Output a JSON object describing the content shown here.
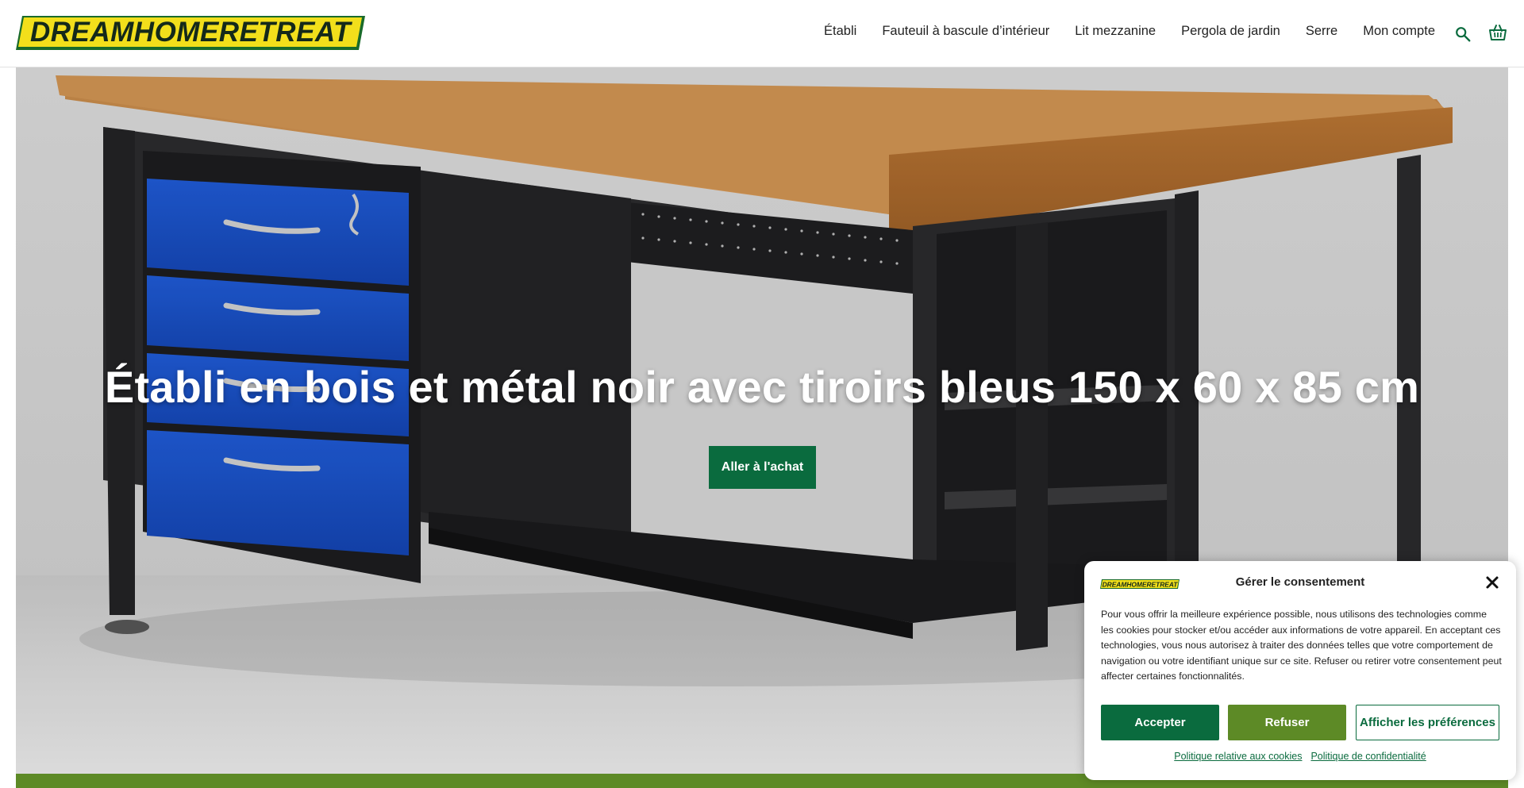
{
  "header": {
    "logo_text": "DREAMHOMERETREAT",
    "nav": [
      {
        "label": "Établi"
      },
      {
        "label": "Fauteuil à bascule d’intérieur"
      },
      {
        "label": "Lit mezzanine"
      },
      {
        "label": "Pergola de jardin"
      },
      {
        "label": "Serre"
      },
      {
        "label": "Mon compte"
      }
    ],
    "search_icon": "search-icon",
    "cart_icon": "shopping-basket-icon"
  },
  "hero": {
    "title": "Établi en bois et métal noir avec tiroirs bleus 150 x 60 x 85 cm",
    "cta_label": "Aller à l'achat"
  },
  "cookie": {
    "title": "Gérer le consentement",
    "logo_text": "DREAMHOMERETREAT",
    "text": "Pour vous offrir la meilleure expérience possible, nous utilisons des technologies comme les cookies pour stocker et/ou accéder aux informations de votre appareil. En acceptant ces technologies, vous nous autorisez à traiter des données telles que votre comportement de navigation ou votre identifiant unique sur ce site. Refuser ou retirer votre consentement peut affecter certaines fonctionnalités.",
    "accept_label": "Accepter",
    "refuse_label": "Refuser",
    "prefs_label": "Afficher les préférences",
    "link_cookies": "Politique relative aux cookies",
    "link_privacy": "Politique de confidentialité"
  },
  "colors": {
    "primary_green": "#0a6b3e",
    "secondary_green": "#5d8a26",
    "logo_yellow": "#f2df1b",
    "drawer_blue": "#1a4fc4"
  }
}
